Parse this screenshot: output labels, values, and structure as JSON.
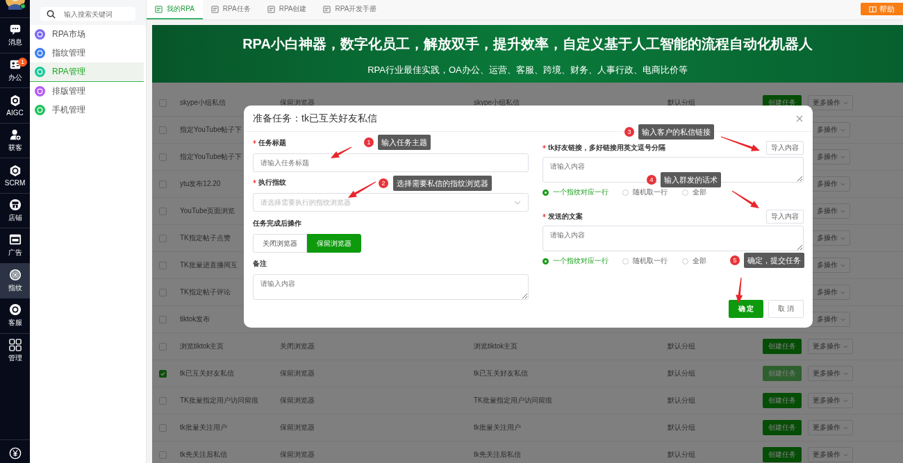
{
  "rail": {
    "items": [
      {
        "label": "消息",
        "selected": false
      },
      {
        "label": "办公",
        "selected": false,
        "badge": "1"
      },
      {
        "label": "AIGC",
        "selected": false
      },
      {
        "label": "获客",
        "selected": false
      },
      {
        "label": "SCRM",
        "selected": false
      },
      {
        "label": "店铺",
        "selected": false
      },
      {
        "label": "广告",
        "selected": false
      },
      {
        "label": "指纹",
        "selected": true
      },
      {
        "label": "客服",
        "selected": false
      },
      {
        "label": "管理",
        "selected": false
      }
    ]
  },
  "sidebar": {
    "search": {
      "placeholder": "输入搜索关键词"
    },
    "items": [
      {
        "label": "RPA市场",
        "color": "#7b6cf0",
        "selected": false
      },
      {
        "label": "指纹管理",
        "color": "#3d7ff5",
        "selected": false
      },
      {
        "label": "RPA管理",
        "color": "#19c99a",
        "selected": true
      },
      {
        "label": "排版管理",
        "color": "#b45cf2",
        "selected": false
      },
      {
        "label": "手机管理",
        "color": "#1fc25a",
        "selected": false
      }
    ]
  },
  "tabs": [
    {
      "label": "我的RPA",
      "selected": true
    },
    {
      "label": "RPA任务",
      "selected": false
    },
    {
      "label": "RPA创建",
      "selected": false
    },
    {
      "label": "RPA开发手册",
      "selected": false
    }
  ],
  "help_button": "帮助",
  "banner": {
    "title": "RPA小白神器，数字化员工，解放双手，提升效率，自定义基于人工智能的流程自动化机器人",
    "subtitle": "RPA行业最佳实践，OA办公、运营、客服、跨境、财务、人事行政、电商比价等"
  },
  "table": {
    "rows": [
      {
        "checked": false,
        "name": "skype小组私信",
        "column_2": "保留浏览器",
        "column_3": "skype小组私信",
        "column_4": "默认分组",
        "create": "创建任务",
        "create_disabled": false,
        "more": "更多操作"
      },
      {
        "checked": false,
        "name": "指定YouTube帖子下",
        "more": "多操作"
      },
      {
        "checked": false,
        "name": "指定YouTube帖子下",
        "more": "多操作"
      },
      {
        "checked": false,
        "name": "ytu发布12.20",
        "more": "多操作"
      },
      {
        "checked": false,
        "name": "YouTube页面浏览",
        "more": "多操作"
      },
      {
        "checked": false,
        "name": "TK指定帖子点赞",
        "more": "多操作"
      },
      {
        "checked": false,
        "name": "TK批量进直播间互",
        "more": "多操作"
      },
      {
        "checked": false,
        "name": "TK指定帖子评论",
        "more": "多操作"
      },
      {
        "checked": false,
        "name": "tiktok发布",
        "more": "多操作"
      },
      {
        "checked": false,
        "name": "浏览tiktok主页",
        "column_2": "关闭浏览器",
        "column_3": "浏览tiktok主页",
        "column_4": "默认分组",
        "create": "创建任务",
        "create_disabled": false,
        "more": "更多操作"
      },
      {
        "checked": true,
        "name": "tk已互关好友私信",
        "column_2": "保留浏览器",
        "column_3": "tk已互关好友私信",
        "column_4": "默认分组",
        "create": "创建任务",
        "create_disabled": true,
        "more": "更多操作"
      },
      {
        "checked": false,
        "name": "TK批量指定用户访问留痕",
        "column_2": "保留浏览器",
        "column_3": "TK批量指定用户访问留痕",
        "column_4": "默认分组",
        "create": "创建任务",
        "create_disabled": false,
        "more": "更多操作"
      },
      {
        "checked": false,
        "name": "tk批量关注用户",
        "column_2": "保留浏览器",
        "column_3": "tk批量关注用户",
        "column_4": "默认分组",
        "create": "创建任务",
        "create_disabled": false,
        "more": "更多操作"
      },
      {
        "checked": false,
        "name": "tk先关注后私信",
        "column_2": "保留浏览器",
        "column_3": "tk先关注后私信",
        "column_4": "默认分组",
        "create": "创建任务",
        "create_disabled": false,
        "more": "更多操作"
      }
    ]
  },
  "dialog": {
    "title": "准备任务：tk已互关好友私信",
    "task_title": {
      "label": "任务标题",
      "required": true,
      "placeholder": "请输入任务标题"
    },
    "fingerprint": {
      "label": "执行指纹",
      "required": true,
      "placeholder": "请选择需要执行的指纹浏览器"
    },
    "after_action": {
      "label": "任务完成后操作",
      "options": [
        {
          "label": "关闭浏览器",
          "selected": false
        },
        {
          "label": "保留浏览器",
          "selected": true
        }
      ]
    },
    "note": {
      "label": "备注",
      "placeholder": "请输入内容"
    },
    "links": {
      "label": "tk好友链接，多好链接用英文逗号分隔",
      "required": true,
      "import": "导入内容",
      "placeholder": "请输入内容",
      "options": [
        {
          "label": "一个指纹对应一行",
          "selected": true
        },
        {
          "label": "随机取一行",
          "selected": false
        },
        {
          "label": "全部",
          "selected": false
        }
      ]
    },
    "message": {
      "label": "发送的文案",
      "required": true,
      "import": "导入内容",
      "placeholder": "请输入内容",
      "options": [
        {
          "label": "一个指纹对应一行",
          "selected": true
        },
        {
          "label": "随机取一行",
          "selected": false
        },
        {
          "label": "全部",
          "selected": false
        }
      ]
    },
    "confirm": "确 定",
    "cancel": "取 消"
  },
  "annotations": [
    {
      "step": "1",
      "text": "输入任务主题"
    },
    {
      "step": "2",
      "text": "选择需要私信的指纹浏览器"
    },
    {
      "step": "3",
      "text": "输入客户的私信链接"
    },
    {
      "step": "4",
      "text": "输入群发的话术"
    },
    {
      "step": "5",
      "text": "确定，提交任务"
    }
  ]
}
